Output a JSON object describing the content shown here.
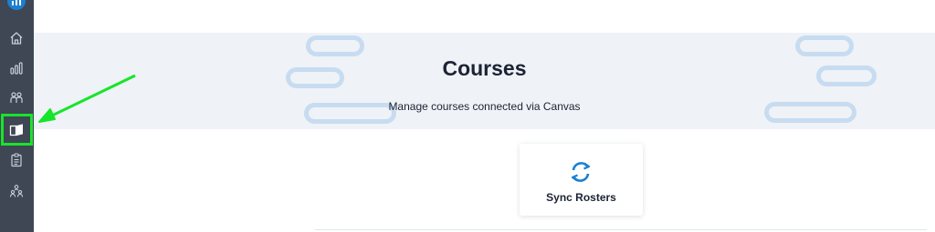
{
  "sidebar": {
    "logo_icon": "bar-chart-logo-icon",
    "items": [
      {
        "icon": "home-icon"
      },
      {
        "icon": "bar-chart-icon"
      },
      {
        "icon": "people-icon"
      },
      {
        "icon": "book-icon",
        "highlighted": true
      },
      {
        "icon": "clipboard-icon"
      },
      {
        "icon": "group-icon"
      }
    ]
  },
  "hero": {
    "title": "Courses",
    "subtitle": "Manage courses connected via Canvas"
  },
  "actions": {
    "sync_rosters_label": "Sync Rosters",
    "sync_icon": "sync-icon"
  },
  "annotation": {
    "highlight_color": "#17e52a",
    "arrow_color": "#17e52a"
  },
  "colors": {
    "sidebar_bg": "#3f4654",
    "accent": "#1b7fd1",
    "hero_bg": "#eff2f7",
    "pill": "#c7dcf0"
  }
}
